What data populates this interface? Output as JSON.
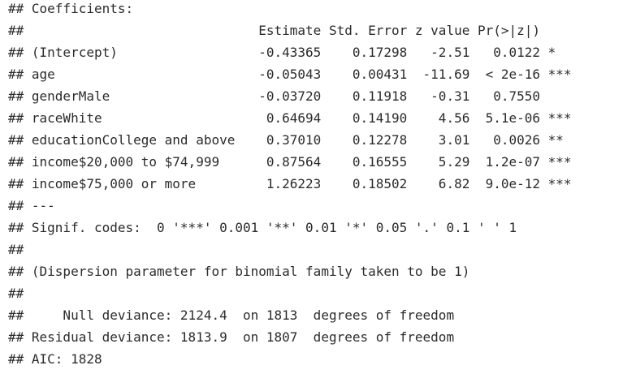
{
  "lines": [
    "## Coefficients:",
    "##                              Estimate Std. Error z value Pr(>|z|)    ",
    "## (Intercept)                  -0.43365    0.17298   -2.51   0.0122 *  ",
    "## age                          -0.05043    0.00431  -11.69  < 2e-16 ***",
    "## genderMale                   -0.03720    0.11918   -0.31   0.7550    ",
    "## raceWhite                     0.64694    0.14190    4.56  5.1e-06 ***",
    "## educationCollege and above    0.37010    0.12278    3.01   0.0026 ** ",
    "## income$20,000 to $74,999      0.87564    0.16555    5.29  1.2e-07 ***",
    "## income$75,000 or more         1.26223    0.18502    6.82  9.0e-12 ***",
    "## ---",
    "## Signif. codes:  0 '***' 0.001 '**' 0.01 '*' 0.05 '.' 0.1 ' ' 1",
    "## ",
    "## (Dispersion parameter for binomial family taken to be 1)",
    "## ",
    "##     Null deviance: 2124.4  on 1813  degrees of freedom",
    "## Residual deviance: 1813.9  on 1807  degrees of freedom",
    "## AIC: 1828"
  ]
}
